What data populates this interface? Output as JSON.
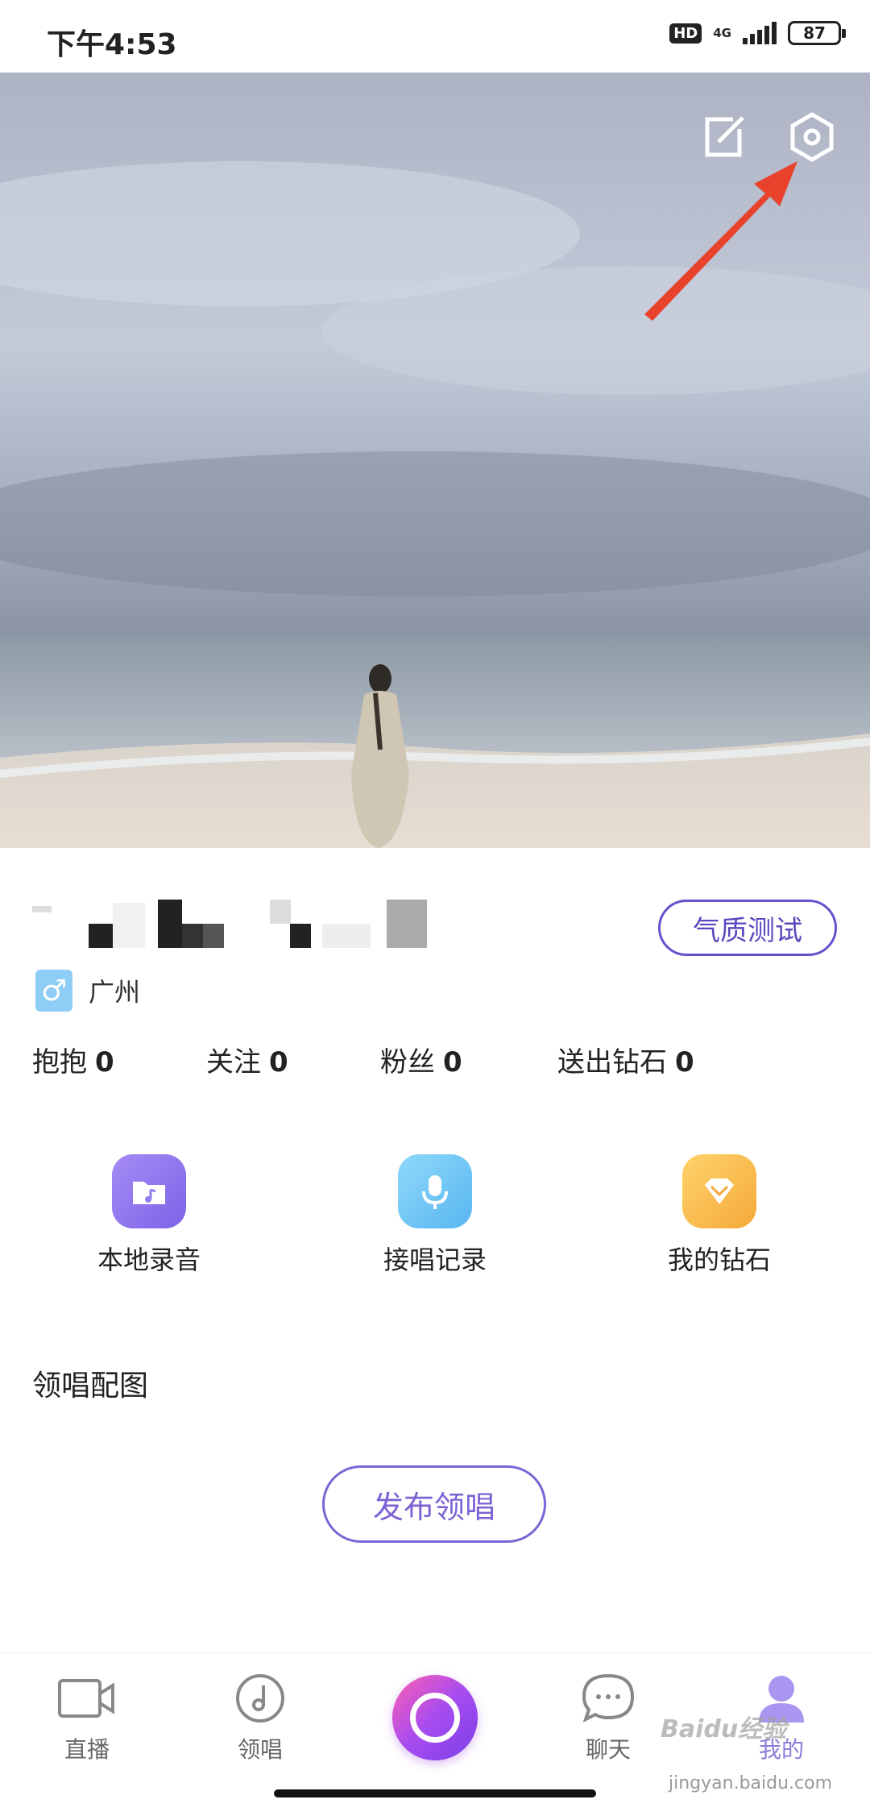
{
  "status_bar": {
    "time": "下午4:53",
    "hd": "HD",
    "network": "4G",
    "battery": "87",
    "icons": [
      "hd-icon",
      "signal-icon",
      "battery-icon"
    ]
  },
  "profile": {
    "city": "广州",
    "gender_symbol": "♂",
    "quality_test_label": "气质测试"
  },
  "stats": [
    {
      "label": "抱抱",
      "value": "0"
    },
    {
      "label": "关注",
      "value": "0"
    },
    {
      "label": "粉丝",
      "value": "0"
    },
    {
      "label": "送出钻石",
      "value": "0"
    }
  ],
  "features": [
    {
      "label": "本地录音",
      "icon": "music-folder-icon",
      "color": "#8f7cf0"
    },
    {
      "label": "接唱记录",
      "icon": "microphone-icon",
      "color": "#6fc6f4"
    },
    {
      "label": "我的钻石",
      "icon": "diamond-icon",
      "color": "#f7b94a"
    }
  ],
  "section": {
    "title": "领唱配图",
    "publish_label": "发布领唱"
  },
  "tabbar": {
    "items": [
      {
        "label": "直播",
        "icon": "video-camera-icon"
      },
      {
        "label": "领唱",
        "icon": "music-note-icon"
      },
      {
        "label": "",
        "icon": "record-button-icon"
      },
      {
        "label": "聊天",
        "icon": "chat-bubble-icon"
      },
      {
        "label": "我的",
        "icon": "user-icon",
        "active": true
      }
    ]
  },
  "watermark": {
    "brand": "Baidu经验",
    "url": "jingyan.baidu.com"
  },
  "colors": {
    "accent": "#7c63d4",
    "annotation_arrow": "#e8412c"
  }
}
